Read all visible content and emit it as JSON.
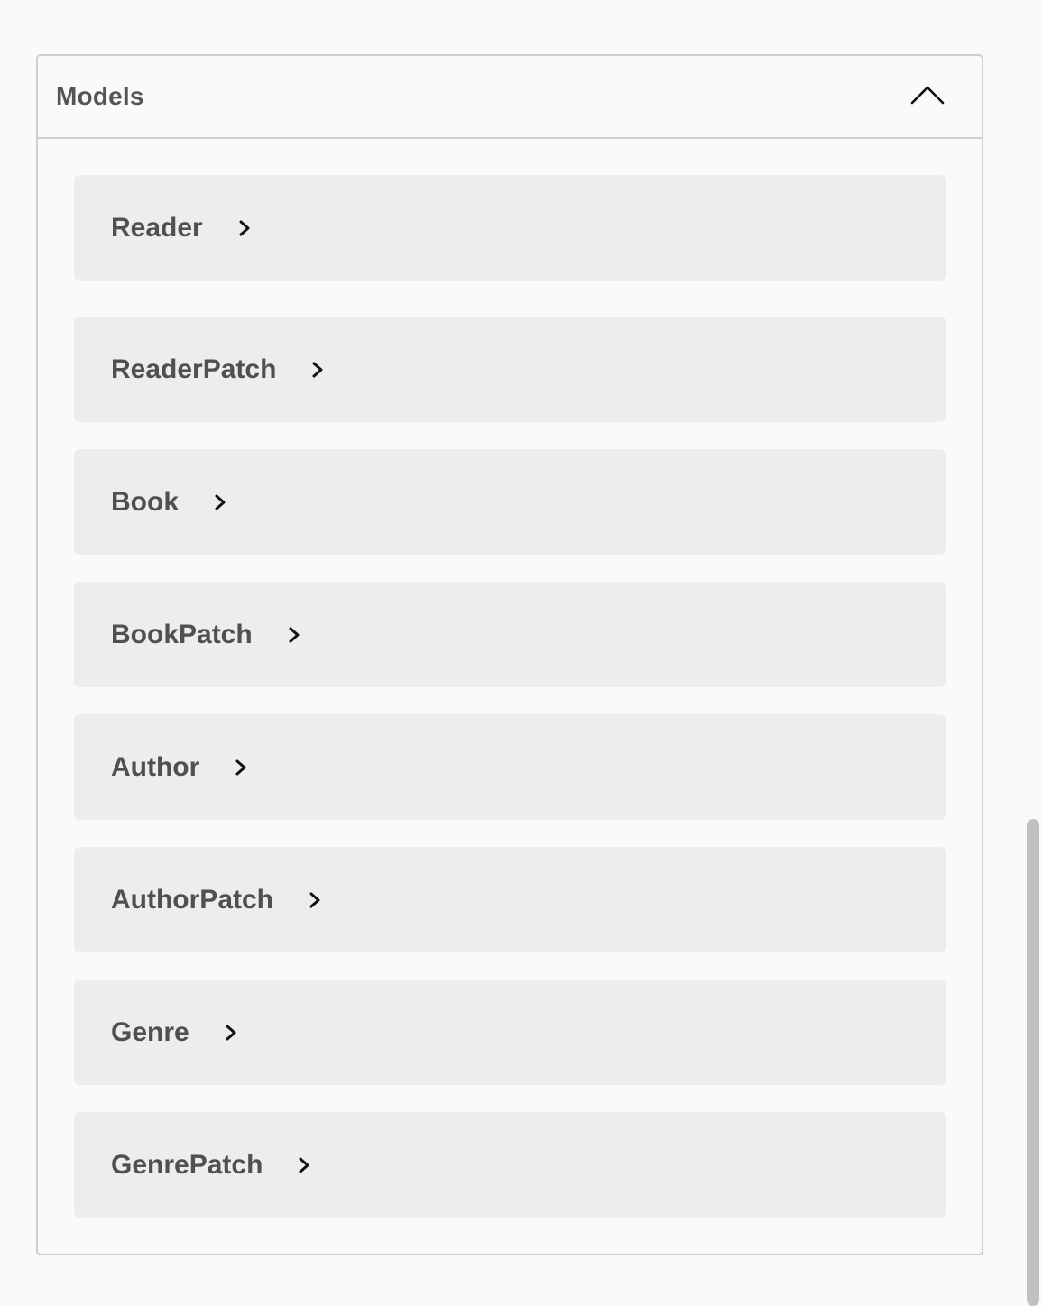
{
  "models": {
    "title": "Models",
    "toggle_icon": "chevron-up-icon",
    "items": [
      {
        "label": "Reader",
        "icon": "chevron-right-icon"
      },
      {
        "label": "ReaderPatch",
        "icon": "chevron-right-icon"
      },
      {
        "label": "Book",
        "icon": "chevron-right-icon"
      },
      {
        "label": "BookPatch",
        "icon": "chevron-right-icon"
      },
      {
        "label": "Author",
        "icon": "chevron-right-icon"
      },
      {
        "label": "AuthorPatch",
        "icon": "chevron-right-icon"
      },
      {
        "label": "Genre",
        "icon": "chevron-right-icon"
      },
      {
        "label": "GenrePatch",
        "icon": "chevron-right-icon"
      }
    ]
  },
  "colors": {
    "background": "#fafafa",
    "border": "#cfcfcf",
    "item_background": "#ededed",
    "text": "#505050"
  }
}
